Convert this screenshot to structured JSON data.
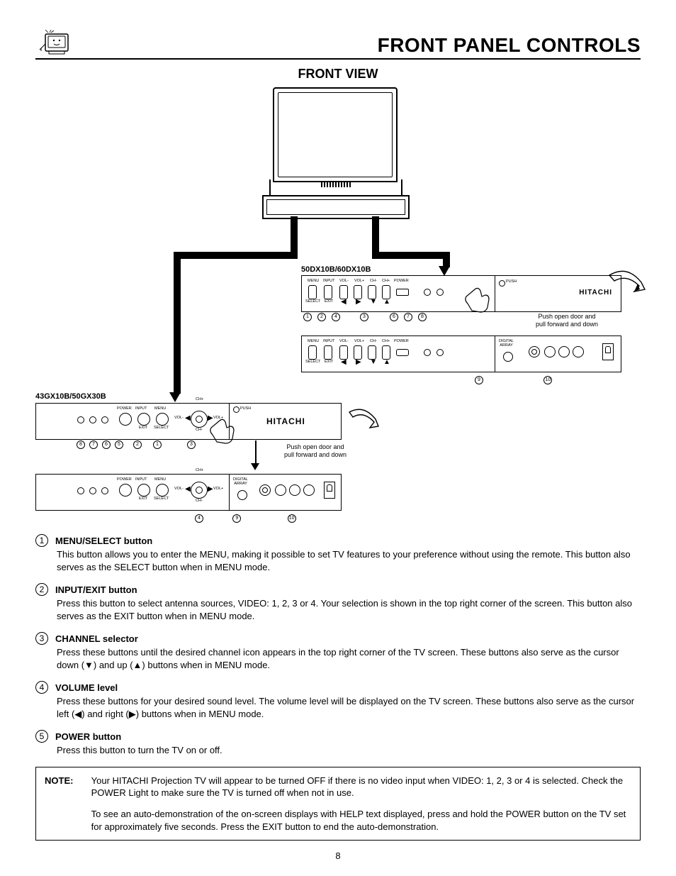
{
  "title": "FRONT PANEL CONTROLS",
  "subtitle": "FRONT VIEW",
  "models": {
    "top": "50DX10B/60DX10B",
    "bottom": "43GX10B/50GX30B"
  },
  "panel_labels": {
    "menu": "MENU",
    "input": "INPUT",
    "volm": "VOL-",
    "volp": "VOL+",
    "chm": "CH-",
    "chp": "CH+",
    "power": "POWER",
    "select": "SELECT",
    "exit": "EXIT",
    "push": "PUSH",
    "digital_array": "DIGITAL\nARRAY",
    "brand": "HITACHI"
  },
  "door_note": "Push open door and\npull forward and down",
  "arrows": {
    "left": "◀",
    "right": "▶",
    "up": "▲",
    "down": "▼"
  },
  "callout_numbers_top": [
    "1",
    "2",
    "4",
    "3",
    "6",
    "7",
    "8"
  ],
  "callout_numbers_top2": [
    "9",
    "10"
  ],
  "callout_numbers_bot": [
    "8",
    "7",
    "6",
    "5",
    "2",
    "1",
    "3"
  ],
  "callout_numbers_bot2": [
    "4",
    "9",
    "10"
  ],
  "definitions": [
    {
      "num": "1",
      "title": "MENU/SELECT button",
      "body": "This button allows you to enter the MENU, making it possible to set TV features to your preference without using the remote.  This button also serves as the SELECT button when in MENU mode."
    },
    {
      "num": "2",
      "title": "INPUT/EXIT button",
      "body": "Press this button to select antenna sources, VIDEO: 1, 2, 3 or 4.  Your selection is shown in the top right corner of the screen.  This button also serves as the EXIT button when in MENU mode."
    },
    {
      "num": "3",
      "title": "CHANNEL selector",
      "body": "Press these buttons until the desired channel icon appears in the top right corner of the TV screen.  These buttons also serve as the cursor down (▼) and up (▲) buttons when in MENU mode."
    },
    {
      "num": "4",
      "title": "VOLUME level",
      "body": "Press these buttons for your desired sound level.  The volume level will be displayed on the TV screen.  These buttons also serve as the cursor left (◀) and right (▶) buttons when in MENU mode."
    },
    {
      "num": "5",
      "title": "POWER button",
      "body": "Press this button to turn the TV on or off."
    }
  ],
  "note": {
    "label": "NOTE:",
    "p1": "Your HITACHI Projection TV will appear to be turned OFF if there is no video input when VIDEO: 1, 2, 3 or 4 is selected.  Check the POWER Light to make sure the TV is turned off when not in use.",
    "p2": "To see an auto-demonstration of the on-screen displays with HELP text displayed, press and hold the POWER button on the TV set for approximately five seconds.  Press the EXIT button to end the auto-demonstration."
  },
  "page_number": "8"
}
